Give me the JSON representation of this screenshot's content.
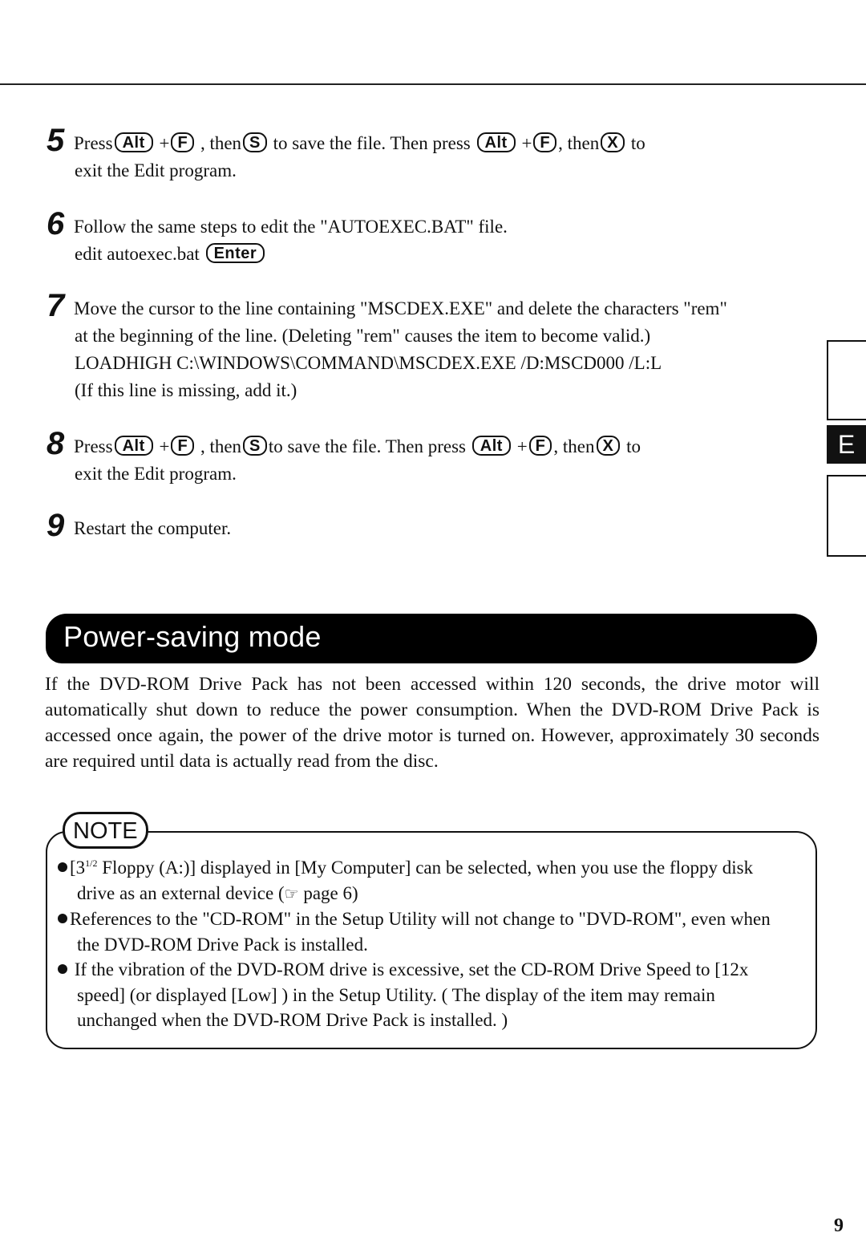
{
  "steps": [
    {
      "number": "5",
      "line1": {
        "t1": "Press",
        "k1": "Alt",
        "t2": "+",
        "k2": "F",
        "t3": ", then",
        "k3": "S",
        "t4": "to save the file.  Then press",
        "k4": "Alt",
        "t5": "+",
        "k5": "F",
        "t6": ", then",
        "k6": "X",
        "t7": "to"
      },
      "line2": "exit the Edit program."
    },
    {
      "number": "6",
      "line1": "Follow the same steps to edit the \"AUTOEXEC.BAT\" file.",
      "line2": "edit autoexec.bat",
      "key": "Enter"
    },
    {
      "number": "7",
      "line1": "Move the cursor to the line containing \"MSCDEX.EXE\" and delete the characters \"rem\"",
      "line2": "at the beginning of the line. (Deleting \"rem\" causes the item to become valid.)",
      "line3": "LOADHIGH  C:\\WINDOWS\\COMMAND\\MSCDEX.EXE /D:MSCD000 /L:L",
      "line4": "(If this line is missing, add it.)"
    },
    {
      "number": "8",
      "line1": {
        "t1": "Press",
        "k1": "Alt",
        "t2": "+",
        "k2": "F",
        "t3": ", then",
        "k3": "S",
        "t4": "to save the file.  Then press",
        "k4": "Alt",
        "t5": "+",
        "k5": "F",
        "t6": ", then",
        "k6": "X",
        "t7": "to"
      },
      "line2": "exit the Edit program."
    },
    {
      "number": "9",
      "line1": "Restart the computer."
    }
  ],
  "side_tab": {
    "label": "E"
  },
  "section": {
    "title": "Power-saving mode",
    "paragraph": "If the DVD-ROM Drive Pack has not been accessed within 120 seconds, the drive motor will automatically shut down to reduce the power consumption.  When the DVD-ROM Drive Pack is accessed once again, the power of the drive motor is turned on.  However, approximately 30 seconds are required until data is actually read from the disc."
  },
  "note": {
    "label": "NOTE",
    "items": [
      {
        "pre": "[3",
        "sup": "1/2",
        "text": " Floppy (A:)] displayed in [My Computer] can be selected, when you use the floppy disk drive as an external device (",
        "icon": "☞",
        "post": " page 6)"
      },
      {
        "text": "References to the \"CD-ROM\"  in the Setup Utility will not change to \"DVD-ROM\", even when the DVD-ROM Drive Pack is installed."
      },
      {
        "text": " If the vibration of the DVD-ROM drive is excessive, set the CD-ROM Drive Speed to [12x speed] (or displayed [Low] ) in the Setup Utility. ( The  display of the item may remain unchanged when the DVD-ROM Drive Pack is installed. )"
      }
    ]
  },
  "page_number": "9"
}
